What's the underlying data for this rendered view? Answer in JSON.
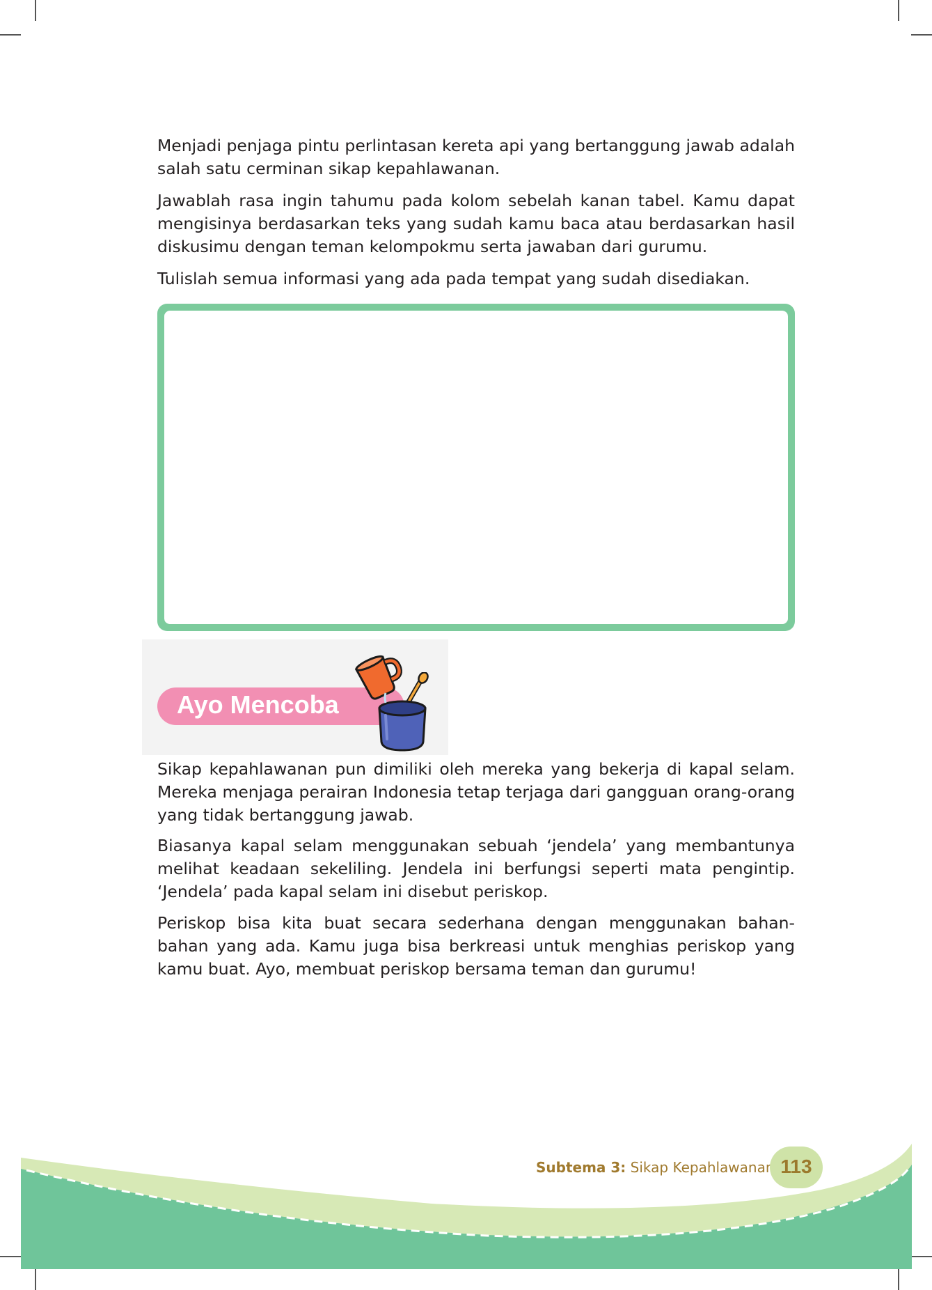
{
  "paragraphs_top": [
    "Menjadi penjaga pintu perlintasan kereta api yang bertanggung jawab adalah salah satu cerminan sikap kepahlawanan.",
    "Jawablah rasa ingin tahumu pada kolom sebelah kanan tabel.  Kamu dapat mengisinya berdasarkan teks yang sudah kamu baca atau berdasarkan hasil diskusimu dengan teman kelompokmu serta jawaban dari gurumu.",
    "Tulislah semua informasi yang ada pada tempat yang sudah disediakan."
  ],
  "answer_box": {
    "value": ""
  },
  "section_heading": "Ayo Mencoba",
  "paragraphs_bottom": [
    "Sikap kepahlawanan pun dimiliki oleh mereka yang bekerja di kapal selam. Mereka menjaga perairan Indonesia tetap terjaga dari gangguan orang-orang yang tidak bertanggung jawab.",
    "Biasanya kapal selam menggunakan sebuah ‘jendela’ yang membantunya melihat keadaan sekeliling. Jendela ini berfungsi seperti mata pengintip. ‘Jendela’ pada kapal selam ini disebut periskop.",
    "Periskop bisa kita buat secara sederhana dengan menggunakan bahan-bahan yang ada. Kamu juga bisa berkreasi untuk menghias periskop yang kamu buat. Ayo, membuat periskop bersama teman dan gurumu!"
  ],
  "footer": {
    "subtheme_label": "Subtema 3:",
    "subtheme_title": " Sikap Kepahlawanan",
    "page_number": "113"
  },
  "icons": [
    "mug-pouring-icon",
    "pot-with-spoon-icon"
  ],
  "colors": {
    "frame_green": "#7ccb9c",
    "heading_pink": "#f28fb3",
    "footer_green": "#6fc59a",
    "footer_light": "#d7e9b6",
    "footer_text": "#a07a2e"
  }
}
